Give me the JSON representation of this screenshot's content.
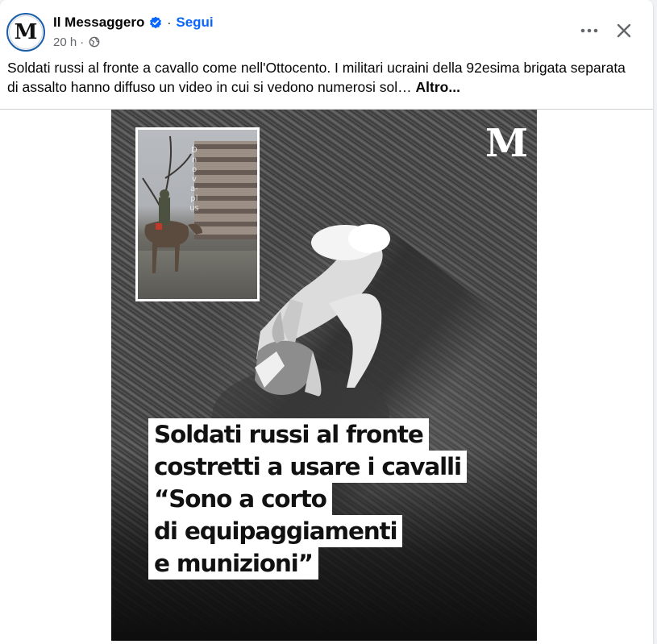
{
  "post": {
    "page_name": "Il Messaggero",
    "avatar_letter": "M",
    "follow_label": "Segui",
    "separator": "·",
    "time_ago": "20 h",
    "audience_icon": "globe-icon",
    "verified_icon": "verified-badge-icon",
    "more_icon": "more-options-icon",
    "close_icon": "close-icon",
    "text": "Soldati russi al fronte a cavallo come nell'Ottocento. I militari ucraini della 92esima brigata separata di assalto hanno diffuso un video in cui si vedono numerosi sol…",
    "see_more_label": "Altro..."
  },
  "media": {
    "logo_letter": "M",
    "inset_watermark": "Dnova-plus",
    "headline_lines": [
      "Soldati russi al fronte",
      "costretti a usare i cavalli",
      "“Sono a corto",
      "di equipaggiamenti",
      "e munizioni”"
    ]
  },
  "colors": {
    "accent": "#0866ff",
    "secondary_text": "#65676b",
    "primary_text": "#050505",
    "avatar_ring": "#1b5ea8"
  }
}
